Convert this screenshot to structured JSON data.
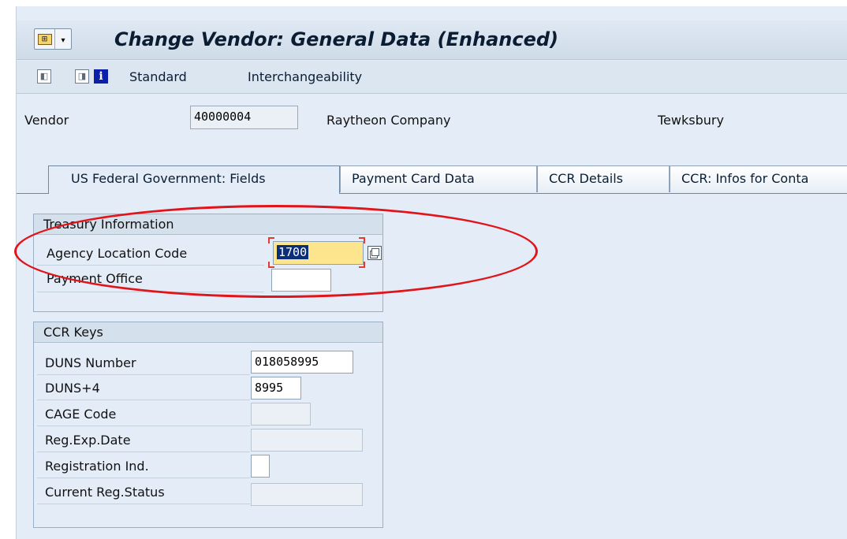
{
  "title": "Change Vendor: General Data (Enhanced)",
  "toolbar": {
    "items": [
      "Standard",
      "Interchangeability"
    ]
  },
  "vendor": {
    "label": "Vendor",
    "number": "40000004",
    "name": "Raytheon Company",
    "city": "Tewksbury"
  },
  "tabs": [
    {
      "label": "US Federal Government: Fields",
      "active": true
    },
    {
      "label": "Payment Card Data",
      "active": false
    },
    {
      "label": "CCR Details",
      "active": false
    },
    {
      "label": "CCR: Infos for Conta",
      "active": false
    }
  ],
  "treasury": {
    "title": "Treasury Information",
    "agency_label": "Agency Location Code",
    "agency_value": "1700",
    "payment_office_label": "Payment Office",
    "payment_office_value": ""
  },
  "ccr": {
    "title": "CCR Keys",
    "rows": [
      {
        "label": "DUNS Number",
        "value": "018058995"
      },
      {
        "label": "DUNS+4",
        "value": "8995"
      },
      {
        "label": "CAGE Code",
        "value": ""
      },
      {
        "label": "Reg.Exp.Date",
        "value": ""
      },
      {
        "label": "Registration Ind.",
        "value": ""
      },
      {
        "label": "Current Reg.Status",
        "value": ""
      }
    ]
  },
  "colors": {
    "highlight_circle": "#e0141a",
    "selected_field": "#fce58c",
    "background": "#e4edf7"
  }
}
